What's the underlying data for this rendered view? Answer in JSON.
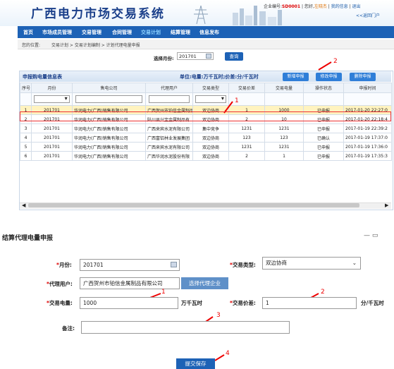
{
  "header": {
    "title": "广西电力市场交易系统",
    "user_prefix": "企业编号:",
    "user_id": "SD0001",
    "greeting": "您好,",
    "user_name": "左晓杰",
    "my_info": "我的信息",
    "logout": "退出",
    "back_portal": "<<返回门户"
  },
  "nav": {
    "items": [
      "首页",
      "市场成员管理",
      "交易管理",
      "合同管理",
      "交易计划",
      "结算管理",
      "信息发布"
    ],
    "active": "交易计划"
  },
  "breadcrumb": {
    "label": "您的位置:",
    "path": "交易计划 > 交易计划编制 > 计划代理电量申报"
  },
  "filter": {
    "month_label": "选择月份:",
    "month_value": "201701",
    "query_button": "查询"
  },
  "list": {
    "title": "申报购电量信息表",
    "unit_label": "单位:电量:万千瓦时;价差:分/千瓦时",
    "buttons": {
      "add": "新增申报",
      "edit": "修改申报",
      "delete": "删除申报"
    },
    "columns": [
      "序号",
      "月份",
      "售电公司",
      "代理用户",
      "交易类型",
      "交易价差",
      "交易电量",
      "操作状态",
      "申报时间"
    ],
    "rows": [
      [
        "1",
        "201701",
        "华润电力(广西)销售有限公司",
        "广西贺州市铂信金属制品",
        "双边协商",
        "1",
        "1000",
        "已申报",
        "2017-01-20 22:27:0"
      ],
      [
        "2",
        "201701",
        "华润电力(广西)销售有限公司",
        "陆川县兴宝金属制品有",
        "双边协商",
        "2",
        "10",
        "已申报",
        "2017-01-20 22:18:4"
      ],
      [
        "3",
        "201701",
        "华润电力(广西)销售有限公司",
        "广西来宾水泥有限公司",
        "集中竞争",
        "1231",
        "1231",
        "已申报",
        "2017-01-19 22:39:2"
      ],
      [
        "4",
        "201701",
        "华润电力(广西)销售有限公司",
        "广西富铝林业发展集团",
        "双边协商",
        "123",
        "123",
        "已确认",
        "2017-01-19 17:37:0"
      ],
      [
        "5",
        "201701",
        "华润电力(广西)销售有限公司",
        "广西来宾水泥有限公司",
        "双边协商",
        "1231",
        "1231",
        "已申报",
        "2017-01-19 17:36:0"
      ],
      [
        "6",
        "201701",
        "华润电力(广西)销售有限公司",
        "广西华润水泥股份有限",
        "双边协商",
        "2",
        "1",
        "已申报",
        "2017-01-19 17:35:3"
      ]
    ]
  },
  "form": {
    "title": "结算代理电量申报",
    "month_label": "月份:",
    "month_value": "201701",
    "trade_type_label": "交易类型:",
    "trade_type_value": "双边协商",
    "agent_label": "代理用户:",
    "agent_value": "广西贺州市铂信金属制品有限公司",
    "select_agent_button": "选择代理企业",
    "quantity_label": "交易电量:",
    "quantity_value": "1000",
    "quantity_unit": "万千瓦时",
    "price_label": "交易价差:",
    "price_value": "1",
    "price_unit": "分/千瓦时",
    "remark_label": "备注:",
    "remark_value": "",
    "submit_button": "提交保存",
    "window_controls": "— ▭"
  },
  "annotations": {
    "list": [
      "1",
      "2"
    ],
    "form": [
      "1",
      "2",
      "3",
      "4"
    ]
  },
  "colors": {
    "nav": "#1d62b6",
    "annotation": "#e00000",
    "highlight_row": "#fff3bf"
  }
}
